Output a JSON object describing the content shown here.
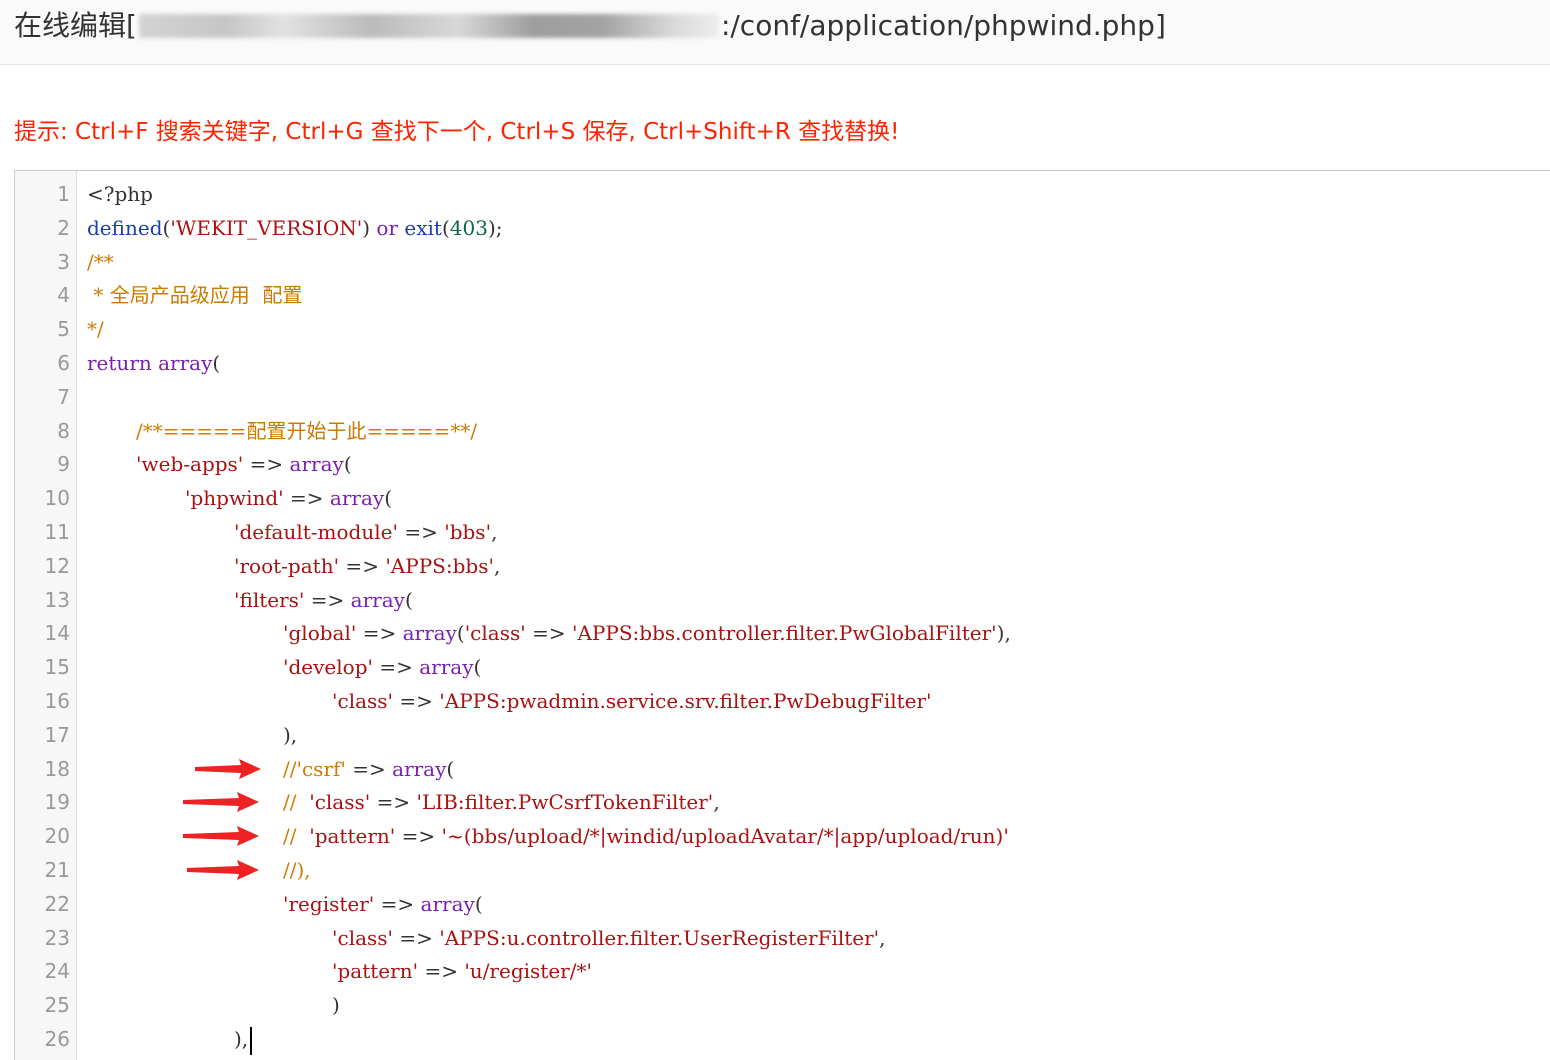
{
  "header": {
    "title_prefix": "在线编辑[",
    "title_suffix": ":/conf/application/phpwind.php]"
  },
  "hint": "提示: Ctrl+F 搜索关键字, Ctrl+G 查找下一个, Ctrl+S 保存, Ctrl+Shift+R 查找替换!",
  "colors": {
    "keyword": "#7a1fb0",
    "string": "#aa1111",
    "comment": "#cc7a00",
    "number": "#116644",
    "arrow": "#ee2222",
    "hint": "#ff2200"
  },
  "editor": {
    "lines": [
      {
        "n": "1",
        "indent": 0,
        "tokens": [
          {
            "t": "plain",
            "v": "<?php"
          }
        ]
      },
      {
        "n": "2",
        "indent": 0,
        "tokens": [
          {
            "t": "fn",
            "v": "defined"
          },
          {
            "t": "plain",
            "v": "("
          },
          {
            "t": "str",
            "v": "'WEKIT_VERSION'"
          },
          {
            "t": "plain",
            "v": ") "
          },
          {
            "t": "kw",
            "v": "or"
          },
          {
            "t": "plain",
            "v": " "
          },
          {
            "t": "fn",
            "v": "exit"
          },
          {
            "t": "plain",
            "v": "("
          },
          {
            "t": "num",
            "v": "403"
          },
          {
            "t": "plain",
            "v": ");"
          }
        ]
      },
      {
        "n": "3",
        "indent": 0,
        "tokens": [
          {
            "t": "com",
            "v": "/**"
          }
        ]
      },
      {
        "n": "4",
        "indent": 0,
        "tokens": [
          {
            "t": "com",
            "v": " * 全局产品级应用  配置"
          }
        ]
      },
      {
        "n": "5",
        "indent": 0,
        "tokens": [
          {
            "t": "com",
            "v": "*/"
          }
        ]
      },
      {
        "n": "6",
        "indent": 0,
        "tokens": [
          {
            "t": "kw",
            "v": "return"
          },
          {
            "t": "plain",
            "v": " "
          },
          {
            "t": "kw",
            "v": "array"
          },
          {
            "t": "plain",
            "v": "("
          }
        ]
      },
      {
        "n": "7",
        "indent": 0,
        "tokens": []
      },
      {
        "n": "8",
        "indent": 1,
        "tokens": [
          {
            "t": "com",
            "v": "/**=====配置开始于此=====**/"
          }
        ]
      },
      {
        "n": "9",
        "indent": 1,
        "tokens": [
          {
            "t": "str",
            "v": "'web-apps'"
          },
          {
            "t": "plain",
            "v": " => "
          },
          {
            "t": "kw",
            "v": "array"
          },
          {
            "t": "plain",
            "v": "("
          }
        ]
      },
      {
        "n": "10",
        "indent": 2,
        "tokens": [
          {
            "t": "str",
            "v": "'phpwind'"
          },
          {
            "t": "plain",
            "v": " => "
          },
          {
            "t": "kw",
            "v": "array"
          },
          {
            "t": "plain",
            "v": "("
          }
        ]
      },
      {
        "n": "11",
        "indent": 3,
        "tokens": [
          {
            "t": "str",
            "v": "'default-module'"
          },
          {
            "t": "plain",
            "v": " => "
          },
          {
            "t": "str",
            "v": "'bbs'"
          },
          {
            "t": "plain",
            "v": ","
          }
        ]
      },
      {
        "n": "12",
        "indent": 3,
        "tokens": [
          {
            "t": "str",
            "v": "'root-path'"
          },
          {
            "t": "plain",
            "v": " => "
          },
          {
            "t": "str",
            "v": "'APPS:bbs'"
          },
          {
            "t": "plain",
            "v": ","
          }
        ]
      },
      {
        "n": "13",
        "indent": 3,
        "tokens": [
          {
            "t": "str",
            "v": "'filters'"
          },
          {
            "t": "plain",
            "v": " => "
          },
          {
            "t": "kw",
            "v": "array"
          },
          {
            "t": "plain",
            "v": "("
          }
        ]
      },
      {
        "n": "14",
        "indent": 4,
        "tokens": [
          {
            "t": "str",
            "v": "'global'"
          },
          {
            "t": "plain",
            "v": " => "
          },
          {
            "t": "kw",
            "v": "array"
          },
          {
            "t": "plain",
            "v": "("
          },
          {
            "t": "str",
            "v": "'class'"
          },
          {
            "t": "plain",
            "v": " => "
          },
          {
            "t": "str",
            "v": "'APPS:bbs.controller.filter.PwGlobalFilter'"
          },
          {
            "t": "plain",
            "v": "),"
          }
        ]
      },
      {
        "n": "15",
        "indent": 4,
        "tokens": [
          {
            "t": "str",
            "v": "'develop'"
          },
          {
            "t": "plain",
            "v": " => "
          },
          {
            "t": "kw",
            "v": "array"
          },
          {
            "t": "plain",
            "v": "("
          }
        ]
      },
      {
        "n": "16",
        "indent": 5,
        "tokens": [
          {
            "t": "str",
            "v": "'class'"
          },
          {
            "t": "plain",
            "v": " => "
          },
          {
            "t": "str",
            "v": "'APPS:pwadmin.service.srv.filter.PwDebugFilter'"
          }
        ]
      },
      {
        "n": "17",
        "indent": 4,
        "tokens": [
          {
            "t": "plain",
            "v": "),"
          }
        ]
      },
      {
        "n": "18",
        "indent": 4,
        "tokens": [
          {
            "t": "com",
            "v": "//'csrf'"
          },
          {
            "t": "plain",
            "v": " => "
          },
          {
            "t": "kw",
            "v": "array"
          },
          {
            "t": "plain",
            "v": "("
          }
        ]
      },
      {
        "n": "19",
        "indent": 4,
        "tokens": [
          {
            "t": "com",
            "v": "//  "
          },
          {
            "t": "str",
            "v": "'class'"
          },
          {
            "t": "plain",
            "v": " => "
          },
          {
            "t": "str",
            "v": "'LIB:filter.PwCsrfTokenFilter'"
          },
          {
            "t": "plain",
            "v": ","
          }
        ]
      },
      {
        "n": "20",
        "indent": 4,
        "tokens": [
          {
            "t": "com",
            "v": "//  "
          },
          {
            "t": "str",
            "v": "'pattern'"
          },
          {
            "t": "plain",
            "v": " => "
          },
          {
            "t": "str",
            "v": "'~(bbs/upload/*|windid/uploadAvatar/*|app/upload/run)'"
          }
        ]
      },
      {
        "n": "21",
        "indent": 4,
        "tokens": [
          {
            "t": "com",
            "v": "//),"
          }
        ]
      },
      {
        "n": "22",
        "indent": 4,
        "tokens": [
          {
            "t": "str",
            "v": "'register'"
          },
          {
            "t": "plain",
            "v": " => "
          },
          {
            "t": "kw",
            "v": "array"
          },
          {
            "t": "plain",
            "v": "("
          }
        ]
      },
      {
        "n": "23",
        "indent": 5,
        "tokens": [
          {
            "t": "str",
            "v": "'class'"
          },
          {
            "t": "plain",
            "v": " => "
          },
          {
            "t": "str",
            "v": "'APPS:u.controller.filter.UserRegisterFilter'"
          },
          {
            "t": "plain",
            "v": ","
          }
        ]
      },
      {
        "n": "24",
        "indent": 5,
        "tokens": [
          {
            "t": "str",
            "v": "'pattern'"
          },
          {
            "t": "plain",
            "v": " => "
          },
          {
            "t": "str",
            "v": "'u/register/*'"
          }
        ]
      },
      {
        "n": "25",
        "indent": 5,
        "tokens": [
          {
            "t": "plain",
            "v": ")"
          }
        ]
      },
      {
        "n": "26",
        "indent": 3,
        "tokens": [
          {
            "t": "plain",
            "v": "),"
          }
        ],
        "cursor": true
      }
    ],
    "arrow_lines": [
      "18",
      "19",
      "20",
      "21"
    ]
  }
}
